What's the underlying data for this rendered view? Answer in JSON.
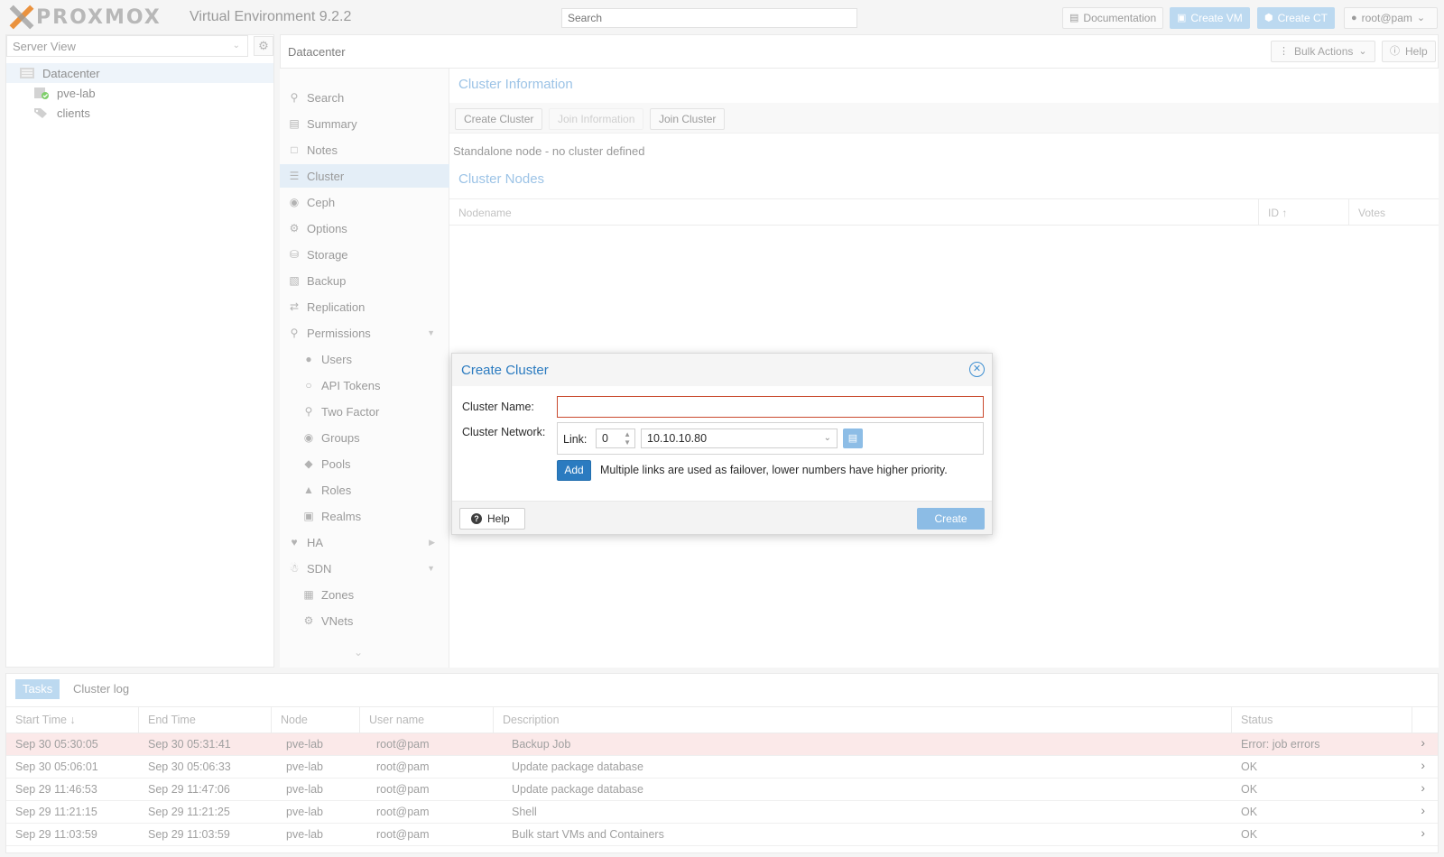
{
  "app": {
    "logo_text": "PROXMOX",
    "version": "Virtual Environment 9.2.2",
    "search_placeholder": "Search",
    "buttons": {
      "documentation": "Documentation",
      "create_vm": "Create VM",
      "create_ct": "Create CT",
      "user": "root@pam"
    }
  },
  "tree": {
    "view": "Server View",
    "items": [
      {
        "label": "Datacenter",
        "icon": "datacenter-icon"
      },
      {
        "label": "pve-lab",
        "icon": "node-online-icon"
      },
      {
        "label": "clients",
        "icon": "tags-icon"
      }
    ]
  },
  "main": {
    "title": "Datacenter",
    "bulk_actions": "Bulk Actions",
    "help": "Help"
  },
  "nav": [
    {
      "label": "Search",
      "icon": "search-icon"
    },
    {
      "label": "Summary",
      "icon": "book-icon"
    },
    {
      "label": "Notes",
      "icon": "notes-icon"
    },
    {
      "label": "Cluster",
      "icon": "server-icon"
    },
    {
      "label": "Ceph",
      "icon": "ceph-icon"
    },
    {
      "label": "Options",
      "icon": "gear-icon"
    },
    {
      "label": "Storage",
      "icon": "database-icon"
    },
    {
      "label": "Backup",
      "icon": "floppy-icon"
    },
    {
      "label": "Replication",
      "icon": "retweet-icon"
    },
    {
      "label": "Permissions",
      "icon": "unlock-icon"
    },
    {
      "label": "Users",
      "icon": "user-icon"
    },
    {
      "label": "API Tokens",
      "icon": "user-outline-icon"
    },
    {
      "label": "Two Factor",
      "icon": "key-icon"
    },
    {
      "label": "Groups",
      "icon": "users-icon"
    },
    {
      "label": "Pools",
      "icon": "tags-icon"
    },
    {
      "label": "Roles",
      "icon": "male-icon"
    },
    {
      "label": "Realms",
      "icon": "address-book-icon"
    },
    {
      "label": "HA",
      "icon": "heartbeat-icon"
    },
    {
      "label": "SDN",
      "icon": "sdn-icon"
    },
    {
      "label": "Zones",
      "icon": "th-icon"
    },
    {
      "label": "VNets",
      "icon": "network-icon"
    }
  ],
  "cluster": {
    "info_title": "Cluster Information",
    "create_cluster": "Create Cluster",
    "join_information": "Join Information",
    "join_cluster": "Join Cluster",
    "standalone": "Standalone node - no cluster defined",
    "nodes_title": "Cluster Nodes",
    "columns": {
      "nodename": "Nodename",
      "id": "ID ↑",
      "votes": "Votes"
    }
  },
  "dialog": {
    "title": "Create Cluster",
    "name_label": "Cluster Name:",
    "name_value": "",
    "network_label": "Cluster Network:",
    "link_label": "Link:",
    "link_value": "0",
    "address_value": "10.10.10.80",
    "add_label": "Add",
    "hint": "Multiple links are used as failover, lower numbers have higher priority.",
    "help_label": "Help",
    "create_label": "Create"
  },
  "tasks": {
    "tabs": [
      "Tasks",
      "Cluster log"
    ],
    "columns": [
      "Start Time ↓",
      "End Time",
      "Node",
      "User name",
      "Description",
      "Status"
    ],
    "rows": [
      {
        "start": "Sep 30 05:30:05",
        "end": "Sep 30 05:31:41",
        "node": "pve-lab",
        "user": "root@pam",
        "desc": "Backup Job",
        "status": "Error: job errors"
      },
      {
        "start": "Sep 30 05:06:01",
        "end": "Sep 30 05:06:33",
        "node": "pve-lab",
        "user": "root@pam",
        "desc": "Update package database",
        "status": "OK"
      },
      {
        "start": "Sep 29 11:46:53",
        "end": "Sep 29 11:47:06",
        "node": "pve-lab",
        "user": "root@pam",
        "desc": "Update package database",
        "status": "OK"
      },
      {
        "start": "Sep 29 11:21:15",
        "end": "Sep 29 11:21:25",
        "node": "pve-lab",
        "user": "root@pam",
        "desc": "Shell",
        "status": "OK"
      },
      {
        "start": "Sep 29 11:03:59",
        "end": "Sep 29 11:03:59",
        "node": "pve-lab",
        "user": "root@pam",
        "desc": "Bulk start VMs and Containers",
        "status": "OK"
      }
    ]
  },
  "colors": {
    "accent": "#2b7bc0",
    "brand_orange": "#e57000",
    "error_row": "#fbe9e9",
    "invalid_border": "#c94a2e"
  }
}
